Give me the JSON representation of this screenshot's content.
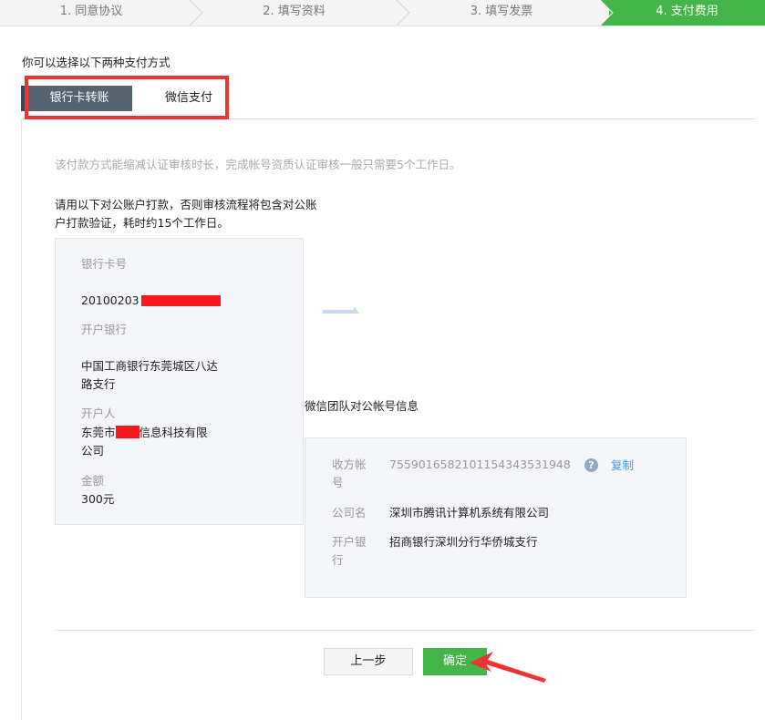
{
  "steps": [
    {
      "label": "1. 同意协议"
    },
    {
      "label": "2. 填写资料"
    },
    {
      "label": "3. 填写发票"
    },
    {
      "label": "4. 支付费用"
    }
  ],
  "intro": "你可以选择以下两种支付方式",
  "tabs": {
    "bank": "银行卡转账",
    "wechat": "微信支付"
  },
  "description": "该付款方式能缩减认证审核时长，完成帐号资质认证审核一般只需要5个工作日。",
  "warning": "请用以下对公账户打款，否则审核流程将包含对公账户打款验证，耗时约15个工作日。",
  "payer": {
    "card_label": "银行卡号",
    "card_value": "20100203",
    "bank_label": "开户银行",
    "bank_value": "中国工商银行东莞城区八达路支行",
    "holder_label": "开户人",
    "holder_value_prefix": "东莞市",
    "holder_value_suffix": "信息科技有限公司",
    "amount_label": "金额",
    "amount_value": "300元"
  },
  "receiver_title": "微信团队对公帐号信息",
  "receiver": {
    "account_label": "收方帐号",
    "account_value": "7559016582101154343531948",
    "copy_label": "复制",
    "help_icon": "?",
    "company_label": "公司名",
    "company_value": "深圳市腾讯计算机系统有限公司",
    "bank_label": "开户银行",
    "bank_value": "招商银行深圳分行华侨城支行"
  },
  "buttons": {
    "prev": "上一步",
    "confirm": "确定"
  },
  "colors": {
    "accent": "#44b549",
    "tab_active": "#556270",
    "annotation": "#ee3333",
    "link": "#459ae9"
  }
}
